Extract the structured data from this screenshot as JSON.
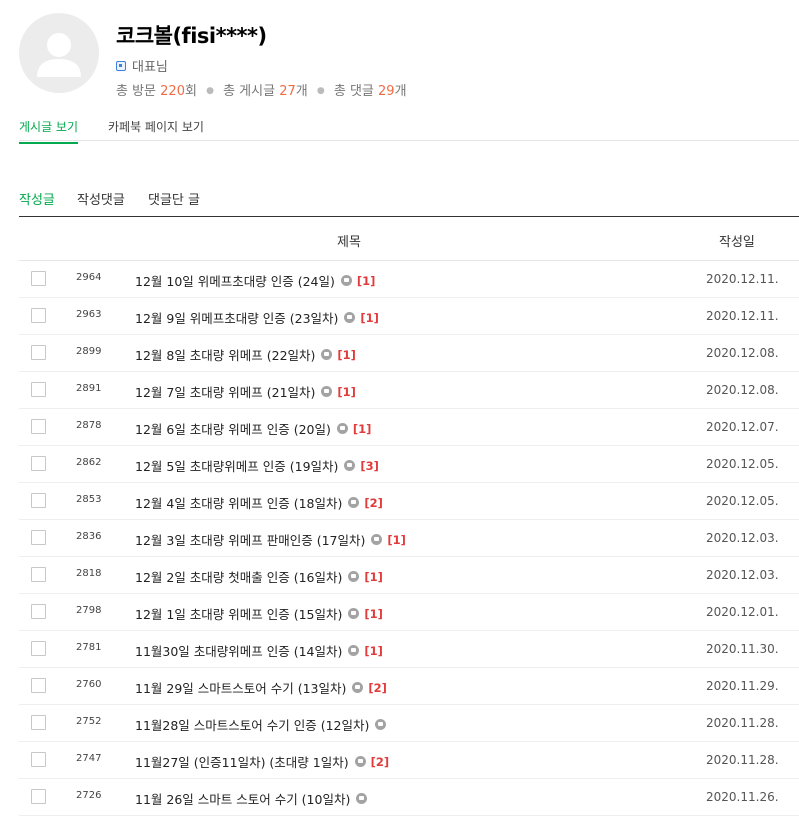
{
  "profile": {
    "nickname": "코크볼(fisi****)",
    "rank": "대표님",
    "stats": {
      "visits_label": "총 방문",
      "visits": "220",
      "visits_unit": "회",
      "posts_label": "총 게시글",
      "posts": "27",
      "posts_unit": "개",
      "comments_label": "총 댓글",
      "comments": "29",
      "comments_unit": "개"
    }
  },
  "tabs": [
    "게시글 보기",
    "카페북 페이지 보기"
  ],
  "subtabs": [
    "작성글",
    "작성댓글",
    "댓글단 글"
  ],
  "table": {
    "headers": {
      "title": "제목",
      "date": "작성일"
    },
    "rows": [
      {
        "no": "2964",
        "title": "12월 10일 위메프초대량 인증 (24일)",
        "image": true,
        "comments": "[1]",
        "date": "2020.12.11."
      },
      {
        "no": "2963",
        "title": "12월 9일 위메프초대량 인증 (23일차)",
        "image": true,
        "comments": "[1]",
        "date": "2020.12.11."
      },
      {
        "no": "2899",
        "title": "12월 8일 초대량 위메프 (22일차)",
        "image": true,
        "comments": "[1]",
        "date": "2020.12.08."
      },
      {
        "no": "2891",
        "title": "12월 7일 초대량 위메프 (21일차)",
        "image": true,
        "comments": "[1]",
        "date": "2020.12.08."
      },
      {
        "no": "2878",
        "title": "12월 6일 초대량 위메프 인증 (20일)",
        "image": true,
        "comments": "[1]",
        "date": "2020.12.07."
      },
      {
        "no": "2862",
        "title": "12월 5일 초대량위메프 인증 (19일차)",
        "image": true,
        "comments": "[3]",
        "date": "2020.12.05."
      },
      {
        "no": "2853",
        "title": "12월 4일 초대량 위메프 인증 (18일차)",
        "image": true,
        "comments": "[2]",
        "date": "2020.12.05."
      },
      {
        "no": "2836",
        "title": "12월 3일 초대량 위메프 판매인증 (17일차)",
        "image": true,
        "comments": "[1]",
        "date": "2020.12.03."
      },
      {
        "no": "2818",
        "title": "12월 2일 초대량 첫매출 인증 (16일차)",
        "image": true,
        "comments": "[1]",
        "date": "2020.12.03."
      },
      {
        "no": "2798",
        "title": "12월 1일 초대량 위메프 인증 (15일차)",
        "image": true,
        "comments": "[1]",
        "date": "2020.12.01."
      },
      {
        "no": "2781",
        "title": "11월30일 초대량위메프 인증 (14일차)",
        "image": true,
        "comments": "[1]",
        "date": "2020.11.30."
      },
      {
        "no": "2760",
        "title": "11월 29일 스마트스토어 수기 (13일차)",
        "image": true,
        "comments": "[2]",
        "date": "2020.11.29."
      },
      {
        "no": "2752",
        "title": "11월28일 스마트스토어 수기 인증 (12일차)",
        "image": true,
        "comments": "",
        "date": "2020.11.28."
      },
      {
        "no": "2747",
        "title": "11월27일 (인증11일차) (초대량 1일차)",
        "image": true,
        "comments": "[2]",
        "date": "2020.11.28."
      },
      {
        "no": "2726",
        "title": "11월 26일 스마트 스토어 수기 (10일차)",
        "image": true,
        "comments": "",
        "date": "2020.11.26."
      }
    ]
  }
}
